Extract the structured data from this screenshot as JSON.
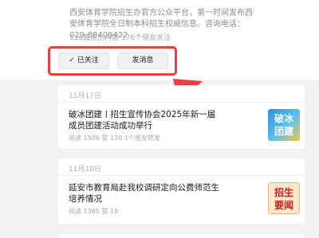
{
  "profile": {
    "intro": "西安体育学院招生办官方公众平台，第一时间发布西安体育学院全日制本科招生权威信息。咨询电话：029-88409422",
    "stats": "116篇原创内容  176个朋友关注",
    "follow_button": "已关注",
    "message_button": "发消息"
  },
  "articles": [
    {
      "date": "11月17日",
      "title": "破冰团建丨招生宣传协会2025年新一届成员团建活动成功举行",
      "meta": "阅读 1506  赞 130  1个朋友转发",
      "thumb_text": "破冰\n团建"
    },
    {
      "date": "11月10日",
      "title": "延安市教育局赴我校调研定向公费师范生培养情况",
      "meta": "阅读 1365  赞 19",
      "thumb_text": "招生\n要闻"
    }
  ],
  "colors": {
    "highlight_red": "#e83f3f",
    "background": "#f2f2f2"
  }
}
